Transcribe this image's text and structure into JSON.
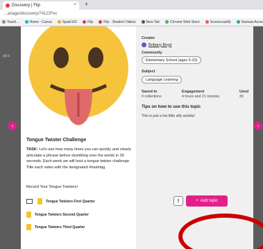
{
  "browser": {
    "tab_title": "Discovery | Flip",
    "tab_close": "×",
    "new_tab": "+",
    "url": "...anage/discovery/74123?vc",
    "bookmarks": [
      {
        "label": "Teach...",
        "color": "#888888"
      },
      {
        "label": "Home - Canva",
        "color": "#00c4cc"
      },
      {
        "label": "Spark101",
        "color": "#f5a623"
      },
      {
        "label": "Flip",
        "color": "#e53935"
      },
      {
        "label": "Flip - Student Videos",
        "color": "#e53935"
      },
      {
        "label": "New Tab",
        "color": "#555555"
      },
      {
        "label": "Chrome Web Store",
        "color": "#4caf50"
      },
      {
        "label": "Screencastify",
        "color": "#ff5252"
      },
      {
        "label": "Seesaw Access Pa...",
        "color": "#26a69a"
      },
      {
        "label": "...",
        "color": "#555555"
      }
    ]
  },
  "background": {
    "left_label": "dd b",
    "arrow_left": "‹",
    "arrow_right": "›"
  },
  "topic": {
    "title": "Tongue Twister Challenge",
    "task_label": "TASK:",
    "task_text": " Let's see how many times you can quickly and clearly articulate a phrase before stumbling over the words in 30 seconds. Each week we will host a tongue twister challenge. Title each video with the designated #hashtag.",
    "record_text": "Record Your Tongue Twisters!",
    "files": [
      "Tongue Twisters First Quarter",
      "Tongue Twisters Second Quarter",
      "Tongue Twisters Third Quarter"
    ]
  },
  "details": {
    "creator_label": "Creator",
    "creator_name": "Brittany Boyd",
    "community_label": "Community",
    "community_value": "Elementary School (ages 5-10)",
    "subject_label": "Subject",
    "subject_value": "Language Learning",
    "saved_label": "Saved to",
    "saved_value": "0 collections",
    "engagement_label": "Engagement",
    "engagement_value": "4 hours and 21 minutes",
    "used_label": "Used",
    "used_value": "30",
    "tips_title": "Tips on how to use this topic",
    "tips_text": "This is just a fun little silly activity!"
  },
  "actions": {
    "share_icon": "⇪",
    "add_topic_plus": "+",
    "add_topic_label": "Add topic",
    "accent_color": "#e3208a",
    "annotation_color": "#cc0000"
  }
}
